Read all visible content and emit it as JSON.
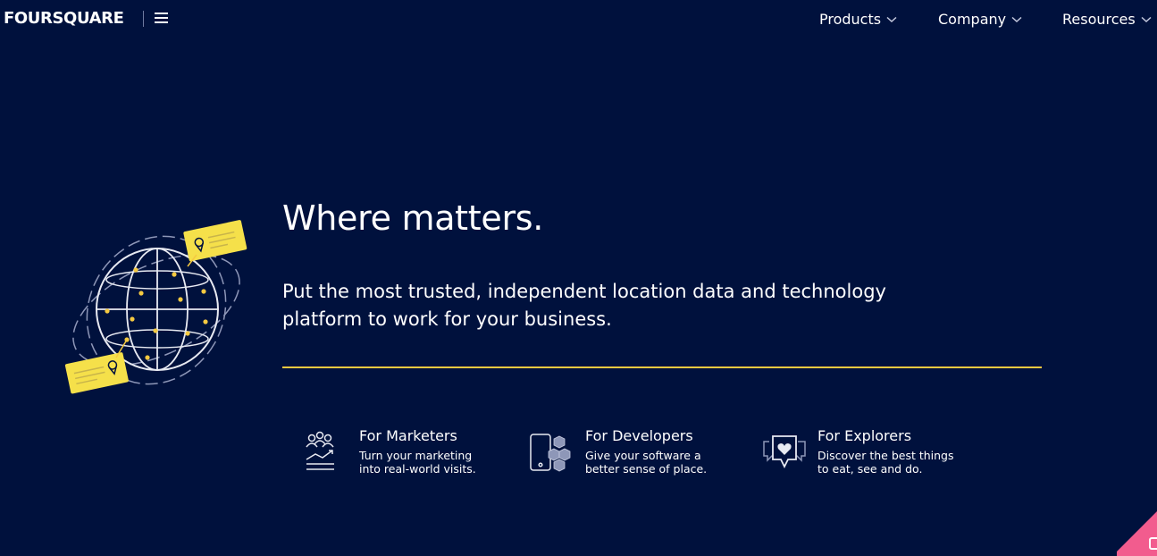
{
  "nav": {
    "logo": "FOURSQUARE",
    "items": [
      {
        "label": "Products"
      },
      {
        "label": "Company"
      },
      {
        "label": "Resources"
      }
    ]
  },
  "hero": {
    "headline": "Where matters.",
    "subhead": "Put the most trusted, independent location data and technology platform to work for your business."
  },
  "audiences": [
    {
      "title": "For Marketers",
      "line1": "Turn your marketing",
      "line2": "into real-world visits."
    },
    {
      "title": "For Developers",
      "line1": "Give your software a",
      "line2": "better sense of place."
    },
    {
      "title": "For Explorers",
      "line1": "Discover the best things",
      "line2": "to eat, see and do."
    }
  ],
  "colors": {
    "background": "#00113d",
    "accent": "#f5c941",
    "text": "#ffffff",
    "corner": "#f25c8e"
  },
  "icons": [
    "menu-icon",
    "chevron-down-icon",
    "globe-illustration",
    "people-icon",
    "phone-blocks-icon",
    "heart-chat-icon"
  ]
}
